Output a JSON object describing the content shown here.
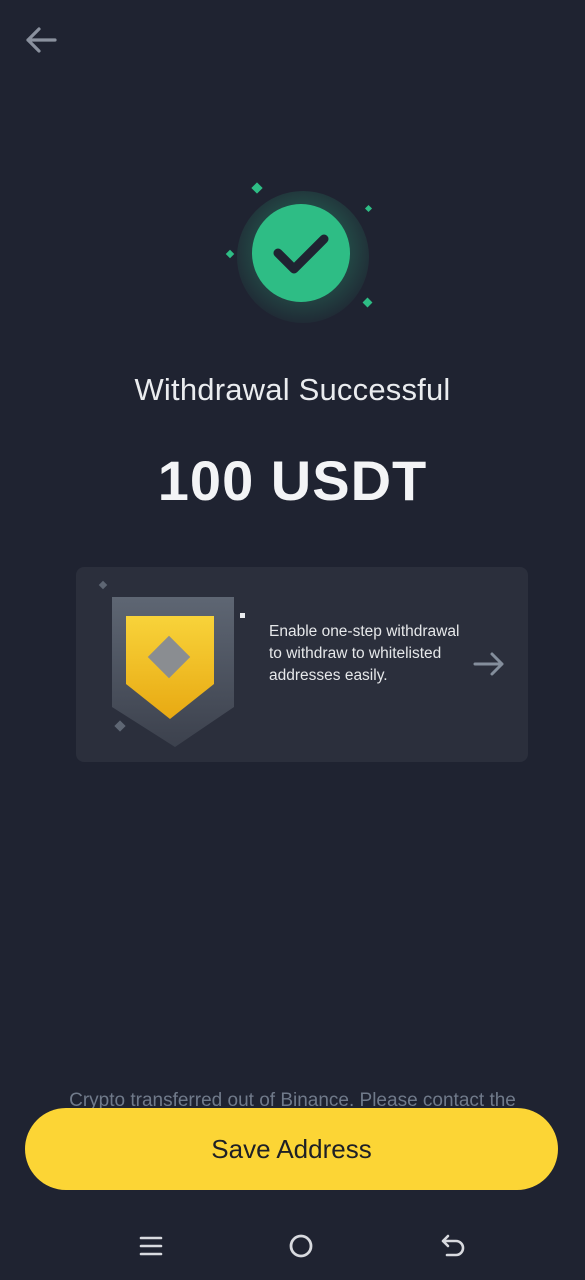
{
  "header": {
    "back_icon": "arrow-left-icon"
  },
  "status": {
    "title": "Withdrawal Successful",
    "amount": "100 USDT",
    "icon": "checkmark-icon",
    "accent_color": "#2ebd85"
  },
  "promo": {
    "text": "Enable one-step withdrawal to withdraw to whitelisted addresses easily.",
    "illustration": "shield-badge-icon",
    "arrow_icon": "arrow-right-icon"
  },
  "footer": {
    "disclaimer": "Crypto transferred out of Binance. Please contact the",
    "save_label": "Save Address",
    "button_color": "#fcd535"
  },
  "navbar": {
    "menu_icon": "menu-icon",
    "home_icon": "home-circle-icon",
    "back_icon": "back-return-icon"
  }
}
